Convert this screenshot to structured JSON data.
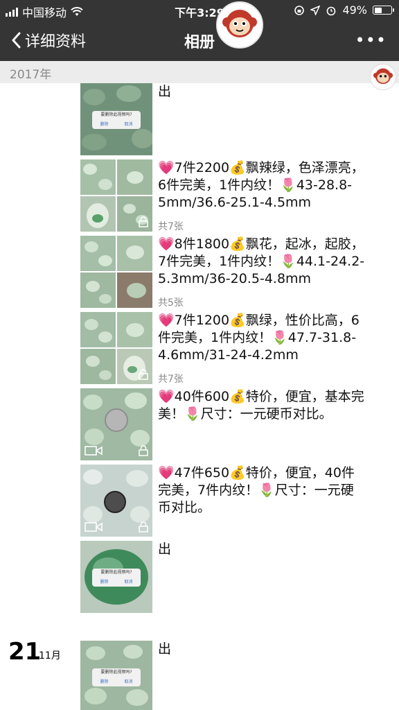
{
  "status_bar": {
    "carrier": "中国移动",
    "time": "下午3:29",
    "battery": "49%",
    "battery_level": 0.49
  },
  "nav": {
    "back_label": "详细资料",
    "title": "相册",
    "more": "•••"
  },
  "year": "2017年",
  "posts": [
    {
      "text": "出"
    },
    {
      "text": "💗7件2200💰飘辣绿，色泽漂亮，6件完美，1件内纹！🌷43-28.8-5mm/36.6-25.1-4.5mm",
      "count": "共7张"
    },
    {
      "text": "💗8件1800💰飘花，起冰，起胶，7件完美，1件内纹！🌷44.1-24.2-5.3mm/36-20.5-4.8mm",
      "count": "共5张"
    },
    {
      "text": "💗7件1200💰飘绿，性价比高，6件完美，1件内纹！🌷47.7-31.8-4.6mm/31-24-4.2mm",
      "count": "共7张"
    },
    {
      "text": "💗40件600💰特价，便宜，基本完美！🌷尺寸：一元硬币对比。"
    },
    {
      "text": "💗47件650💰特价，便宜，40件完美，7件内纹！🌷尺寸：一元硬币对比。"
    },
    {
      "text": "出"
    },
    {
      "text": "出"
    }
  ],
  "date": {
    "day": "21",
    "month": "11月"
  }
}
